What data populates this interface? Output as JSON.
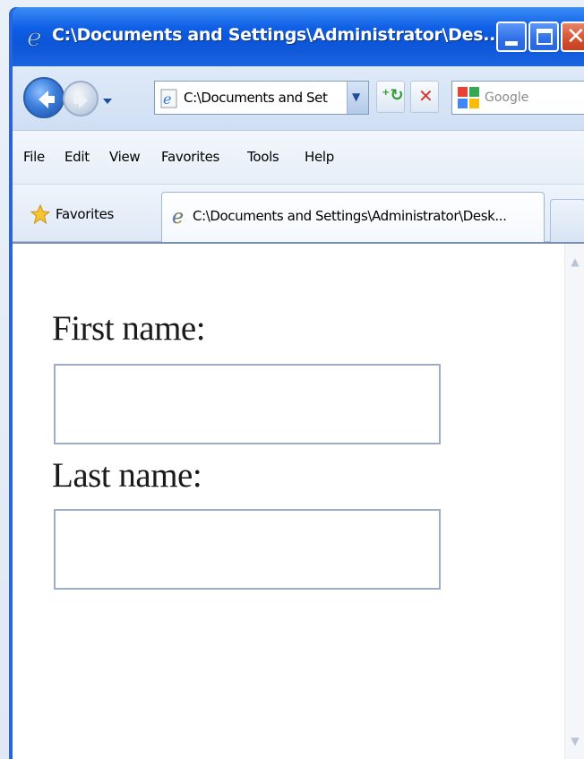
{
  "window": {
    "title": "C:\\Documents and Settings\\Administrator\\Des..."
  },
  "navbar": {
    "address": "C:\\Documents and Set",
    "search_placeholder": "Google"
  },
  "menu": {
    "items": [
      "File",
      "Edit",
      "View",
      "Favorites",
      "Tools",
      "Help"
    ]
  },
  "favbar": {
    "favorites_label": "Favorites",
    "tab_label": "C:\\Documents and Settings\\Administrator\\Desk..."
  },
  "form": {
    "first_name_label": "First name:",
    "first_name_value": "",
    "last_name_label": "Last name:",
    "last_name_value": ""
  },
  "colors": {
    "titlebar": "#0b55d8",
    "close_button": "#d7502d",
    "content_background": "#ffffff"
  },
  "icons": {
    "title": "ie-icon",
    "back": "back-arrow-icon",
    "forward": "forward-arrow-icon",
    "refresh": "refresh-icon",
    "stop": "stop-icon",
    "search": "google-icon",
    "favorites": "star-icon"
  }
}
